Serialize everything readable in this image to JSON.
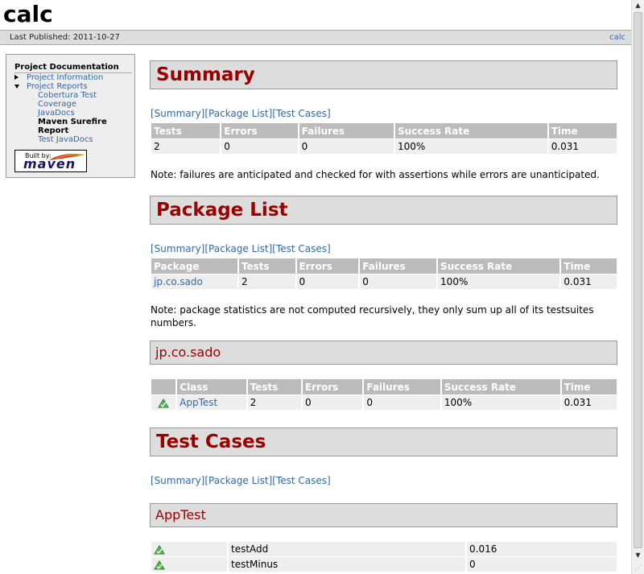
{
  "banner": {
    "title": "calc"
  },
  "breadcrumbs": {
    "last_published": "Last Published: 2011-10-27",
    "project_link": "calc"
  },
  "sidebar": {
    "heading": "Project Documentation",
    "items": [
      {
        "label": "Project Information"
      },
      {
        "label": "Project Reports",
        "children": [
          {
            "label": "Cobertura Test Coverage"
          },
          {
            "label": "JavaDocs"
          },
          {
            "label": "Maven Surefire Report"
          },
          {
            "label": "Test JavaDocs"
          }
        ]
      }
    ],
    "badge": {
      "built_by": "Built by:",
      "logo_text": "maven"
    }
  },
  "quicklinks": {
    "summary": "[Summary]",
    "package_list": "[Package List]",
    "test_cases": "[Test Cases]"
  },
  "summary": {
    "title": "Summary",
    "headers": [
      "Tests",
      "Errors",
      "Failures",
      "Success Rate",
      "Time"
    ],
    "row": [
      "2",
      "0",
      "0",
      "100%",
      "0.031"
    ],
    "note": "Note: failures are anticipated and checked for with assertions while errors are unanticipated."
  },
  "package_list": {
    "title": "Package List",
    "headers": [
      "Package",
      "Tests",
      "Errors",
      "Failures",
      "Success Rate",
      "Time"
    ],
    "row": [
      "jp.co.sado",
      "2",
      "0",
      "0",
      "100%",
      "0.031"
    ],
    "note": "Note: package statistics are not computed recursively, they only sum up all of its testsuites numbers."
  },
  "package": {
    "title": "jp.co.sado",
    "headers": [
      "",
      "Class",
      "Tests",
      "Errors",
      "Failures",
      "Success Rate",
      "Time"
    ],
    "row": [
      "AppTest",
      "2",
      "0",
      "0",
      "100%",
      "0.031"
    ]
  },
  "test_cases": {
    "title": "Test Cases",
    "class_title": "AppTest",
    "rows": [
      {
        "name": "testAdd",
        "time": "0.016"
      },
      {
        "name": "testMinus",
        "time": "0"
      }
    ]
  },
  "icons": {
    "pass": "success-icon",
    "accent": "#990000",
    "link": "#3366aa"
  }
}
